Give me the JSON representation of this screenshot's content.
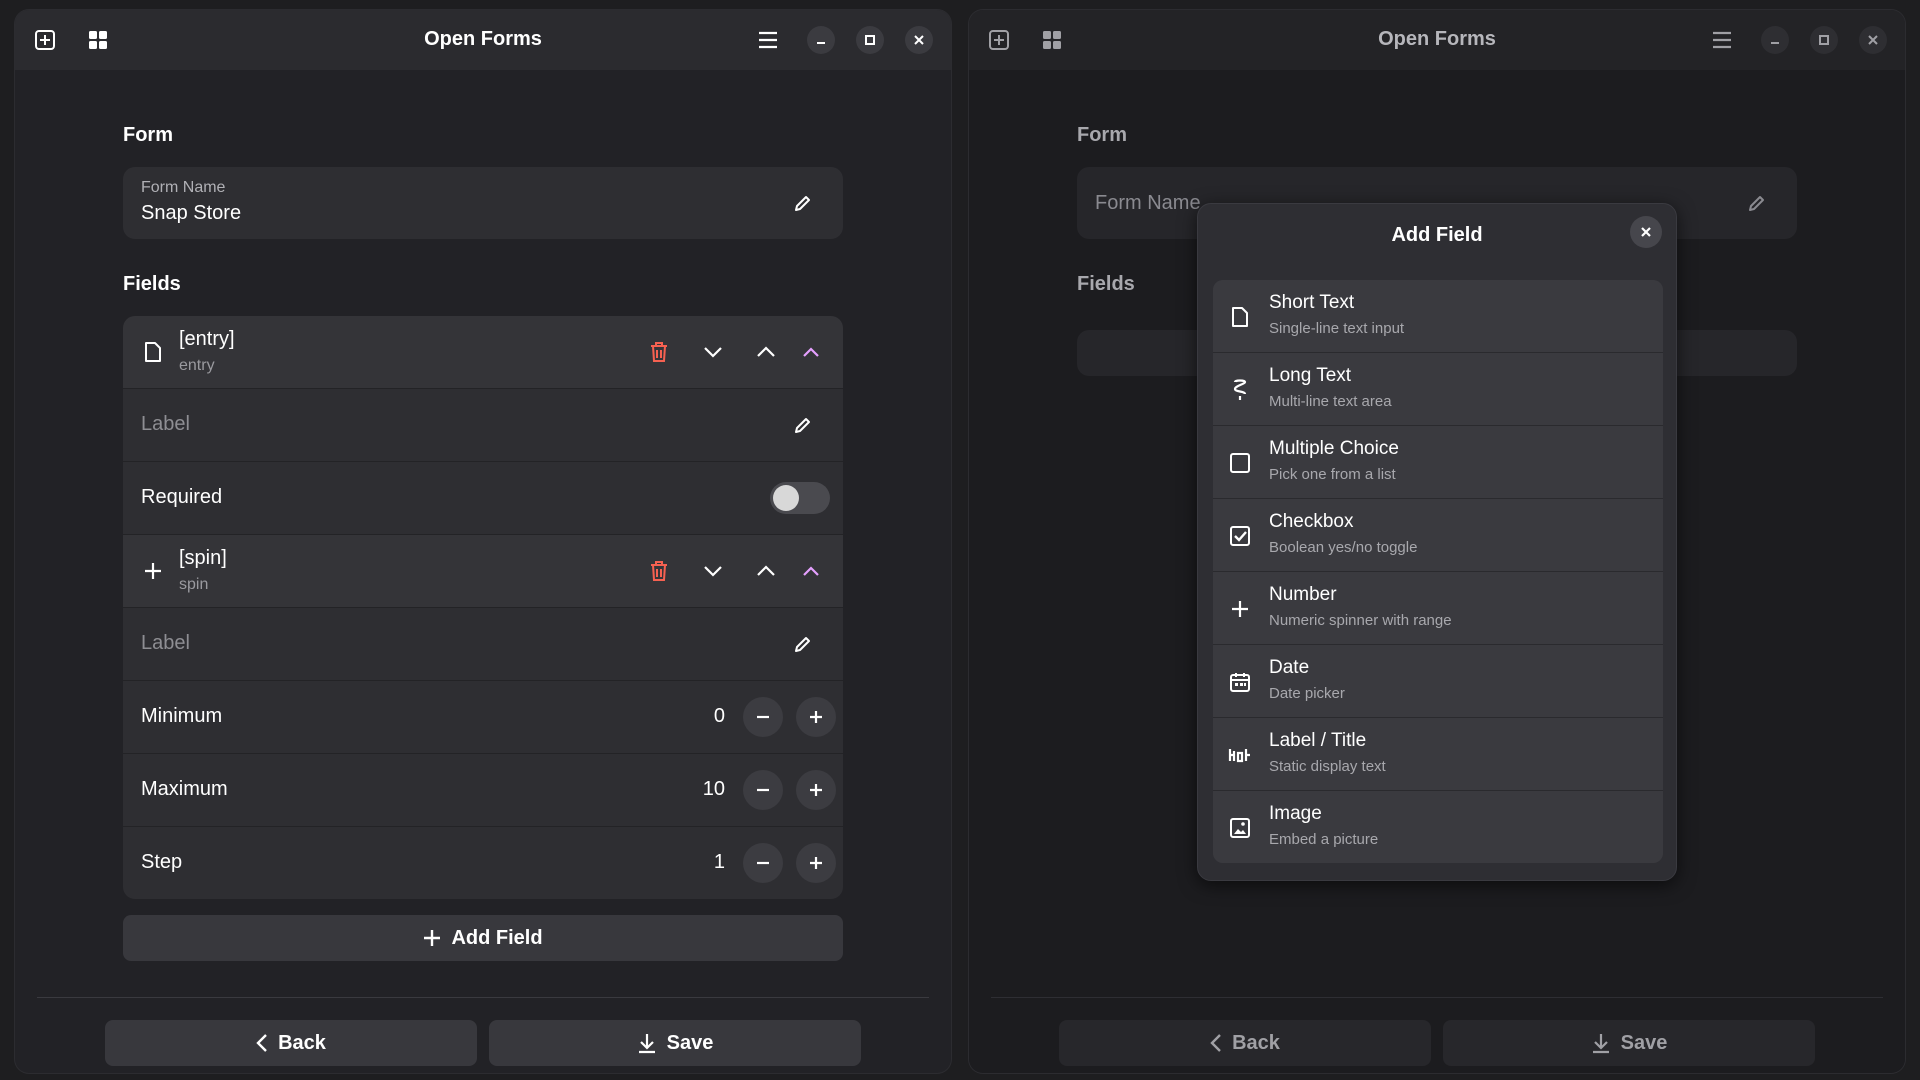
{
  "app_title": "Open Forms",
  "colors": {
    "accent": "#e5a0ff",
    "destructive": "#f66151",
    "window_bg": "#222226",
    "card_bg": "#2e2e32"
  },
  "left": {
    "form_section_title": "Form",
    "form_name_label": "Form Name",
    "form_name_value": "Snap Store",
    "fields_section_title": "Fields",
    "fields": [
      {
        "title": "[entry]",
        "subtitle": "entry",
        "icon": "document-icon",
        "label_placeholder": "Label",
        "required_label": "Required",
        "required": false
      },
      {
        "title": "[spin]",
        "subtitle": "spin",
        "icon": "plus-icon",
        "label_placeholder": "Label",
        "minimum_label": "Minimum",
        "minimum_value": "0",
        "maximum_label": "Maximum",
        "maximum_value": "10",
        "step_label": "Step",
        "step_value": "1"
      }
    ],
    "add_field_label": "Add Field",
    "back_label": "Back",
    "save_label": "Save"
  },
  "right": {
    "form_section_title": "Form",
    "form_name_placeholder": "Form Name",
    "fields_section_title": "Fields",
    "back_label": "Back",
    "save_label": "Save"
  },
  "dialog": {
    "title": "Add Field",
    "items": [
      {
        "title": "Short Text",
        "subtitle": "Single-line text input",
        "icon": "document-icon"
      },
      {
        "title": "Long Text",
        "subtitle": "Multi-line text area",
        "icon": "paragraph-icon"
      },
      {
        "title": "Multiple Choice",
        "subtitle": "Pick one from a list",
        "icon": "checkbox-empty-icon"
      },
      {
        "title": "Checkbox",
        "subtitle": "Boolean yes/no toggle",
        "icon": "checkbox-checked-icon"
      },
      {
        "title": "Number",
        "subtitle": "Numeric spinner with range",
        "icon": "plus-icon"
      },
      {
        "title": "Date",
        "subtitle": "Date picker",
        "icon": "calendar-icon"
      },
      {
        "title": "Label / Title",
        "subtitle": "Static display text",
        "icon": "text-label-icon"
      },
      {
        "title": "Image",
        "subtitle": "Embed a picture",
        "icon": "image-icon"
      }
    ]
  }
}
